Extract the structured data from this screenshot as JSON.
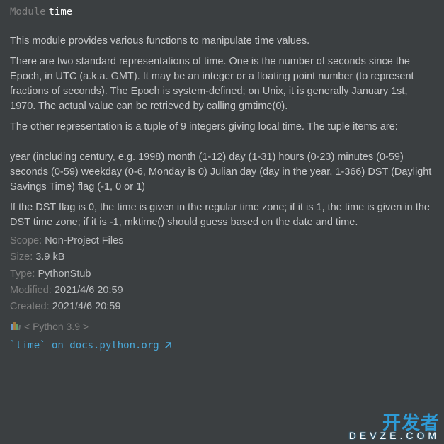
{
  "header": {
    "keyword": "Module",
    "name": "time"
  },
  "doc": {
    "p1": "This module provides various functions to manipulate time values.",
    "p2": "There are two standard representations of time. One is the number of seconds since the Epoch, in UTC (a.k.a. GMT). It may be an integer or a floating point number (to represent fractions of seconds). The Epoch is system-defined; on Unix, it is generally January 1st, 1970. The actual value can be retrieved by calling gmtime(0).",
    "p3": "The other representation is a tuple of 9 integers giving local time. The tuple items are:",
    "p4": "year (including century, e.g. 1998) month (1-12) day (1-31) hours (0-23) minutes (0-59) seconds (0-59) weekday (0-6, Monday is 0) Julian day (day in the year, 1-366) DST (Daylight Savings Time) flag (-1, 0 or 1)",
    "p5": "If the DST flag is 0, the time is given in the regular time zone; if it is 1, the time is given in the DST time zone; if it is -1, mktime() should guess based on the date and time."
  },
  "meta": {
    "scope_label": "Scope:",
    "scope_value": "Non-Project Files",
    "size_label": "Size:",
    "size_value": "3.9 kB",
    "type_label": "Type:",
    "type_value": "PythonStub",
    "modified_label": "Modified:",
    "modified_value": "2021/4/6 20:59",
    "created_label": "Created:",
    "created_value": "2021/4/6 20:59"
  },
  "location": {
    "sdk": "< Python 3.9 >"
  },
  "link": {
    "text": "`time` on docs.python.org"
  },
  "watermark": {
    "line1": "开发者",
    "line2": "DEVZE.COM"
  },
  "colors": {
    "bg": "#3b3f41",
    "link": "#4aa8d8",
    "muted": "#808080",
    "text": "#c8c9cb"
  }
}
